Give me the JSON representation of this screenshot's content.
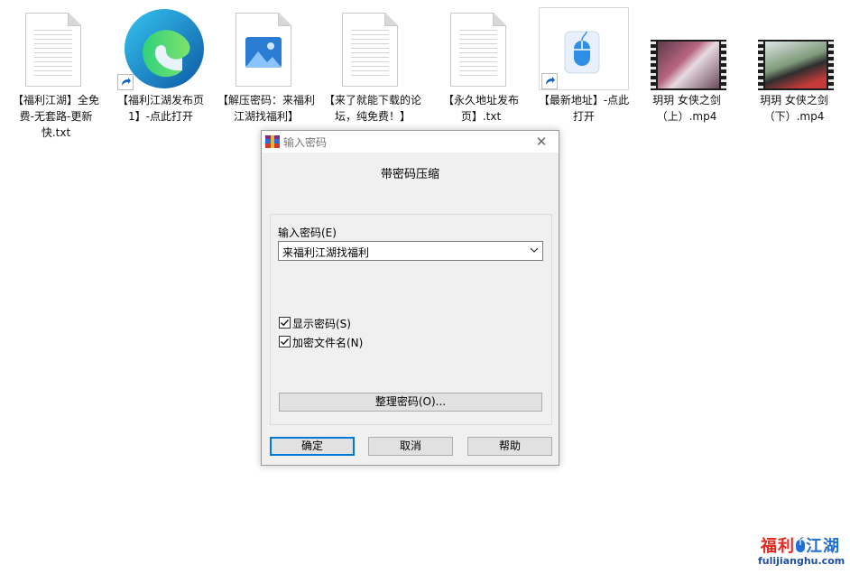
{
  "desktop": {
    "icons": [
      {
        "label": "【福利江湖】全免费-无套路-更新快.txt",
        "type": "text-file-icon"
      },
      {
        "label": "【福利江湖发布页1】-点此打开",
        "type": "edge-shortcut-icon"
      },
      {
        "label": "【解压密码：来福利江湖找福利】",
        "type": "image-file-icon"
      },
      {
        "label": "【来了就能下载的论坛，纯免费！】",
        "type": "text-file-icon"
      },
      {
        "label": "【永久地址发布页】.txt",
        "type": "text-file-icon"
      },
      {
        "label": "【最新地址】-点此打开",
        "type": "mouse-shortcut-icon"
      },
      {
        "label": "玥玥 女侠之剑（上）.mp4",
        "type": "video-file-icon"
      },
      {
        "label": "玥玥 女侠之剑（下）.mp4",
        "type": "video-file-icon"
      }
    ]
  },
  "dialog": {
    "title": "输入密码",
    "subtitle": "带密码压缩",
    "password_label": "输入密码(E)",
    "password_value": "来福利江湖找福利",
    "show_password": {
      "label": "显示密码(S)",
      "checked": true
    },
    "encrypt_names": {
      "label": "加密文件名(N)",
      "checked": true
    },
    "organize_button": "整理密码(O)...",
    "ok_button": "确定",
    "cancel_button": "取消",
    "help_button": "帮助"
  },
  "watermark": {
    "title": "福利江湖",
    "url": "fulijianghu.com"
  },
  "colors": {
    "accent": "#0078d7",
    "dialog_bg": "#f0f0f0",
    "watermark_red": "#e0281e",
    "watermark_blue": "#1f6fd6"
  }
}
